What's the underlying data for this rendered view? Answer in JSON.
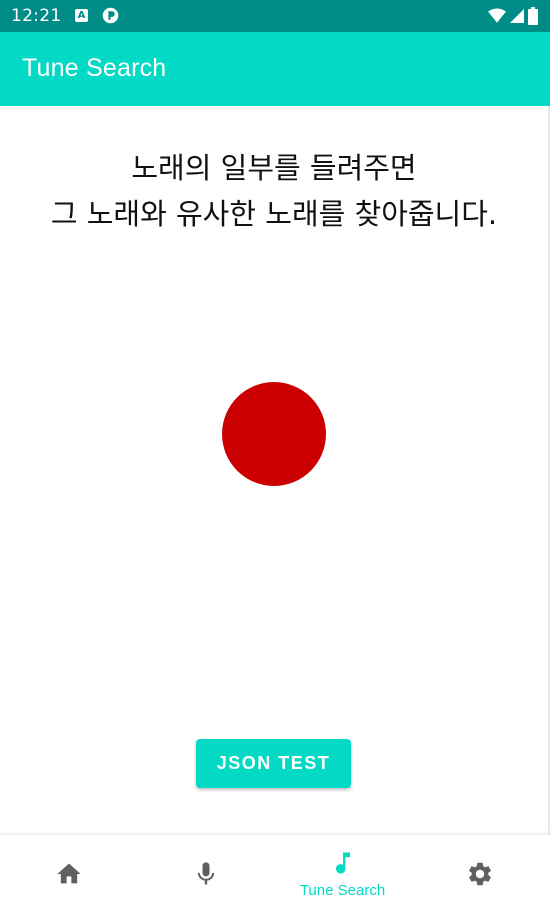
{
  "status_bar": {
    "time": "12:21",
    "icons": [
      "notification-a-icon",
      "notification-r-icon",
      "wifi-icon",
      "cell-signal-icon",
      "battery-icon"
    ]
  },
  "app_bar": {
    "title": "Tune Search"
  },
  "content": {
    "instruction_line1": "노래의 일부를 들려주면",
    "instruction_line2": "그 노래와 유사한 노래를 찾아줍니다.",
    "record_button_color": "#cc0000",
    "json_test_label": "JSON TEST"
  },
  "bottom_nav": {
    "items": [
      {
        "icon": "home-icon",
        "label": ""
      },
      {
        "icon": "microphone-icon",
        "label": ""
      },
      {
        "icon": "music-note-icon",
        "label": "Tune Search",
        "active": true
      },
      {
        "icon": "gear-icon",
        "label": ""
      }
    ]
  },
  "colors": {
    "status_bar": "#008c86",
    "accent": "#03dac5",
    "inactive_icon": "#606060",
    "record": "#cc0000"
  }
}
